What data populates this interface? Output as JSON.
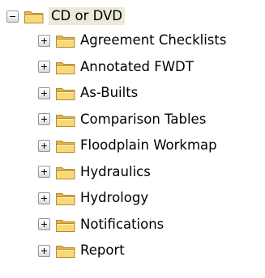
{
  "tree": {
    "root": {
      "label": "CD or DVD",
      "expander": "−",
      "icon": "folder-icon"
    },
    "children": [
      {
        "label": "Agreement Checklists",
        "expander": "+",
        "icon": "folder-icon"
      },
      {
        "label": "Annotated FWDT",
        "expander": "+",
        "icon": "folder-icon"
      },
      {
        "label": "As-Builts",
        "expander": "+",
        "icon": "folder-icon"
      },
      {
        "label": "Comparison Tables",
        "expander": "+",
        "icon": "folder-icon"
      },
      {
        "label": "Floodplain Workmap",
        "expander": "+",
        "icon": "folder-icon"
      },
      {
        "label": "Hydraulics",
        "expander": "+",
        "icon": "folder-icon"
      },
      {
        "label": "Hydrology",
        "expander": "+",
        "icon": "folder-icon"
      },
      {
        "label": "Notifications",
        "expander": "+",
        "icon": "folder-icon"
      },
      {
        "label": "Report",
        "expander": "+",
        "icon": "folder-icon"
      }
    ]
  },
  "colors": {
    "folder_fill": "#f5d36b",
    "folder_edge": "#c9a13b",
    "selection_bg": "#ece9d8",
    "expander_border": "#8b98a8"
  }
}
